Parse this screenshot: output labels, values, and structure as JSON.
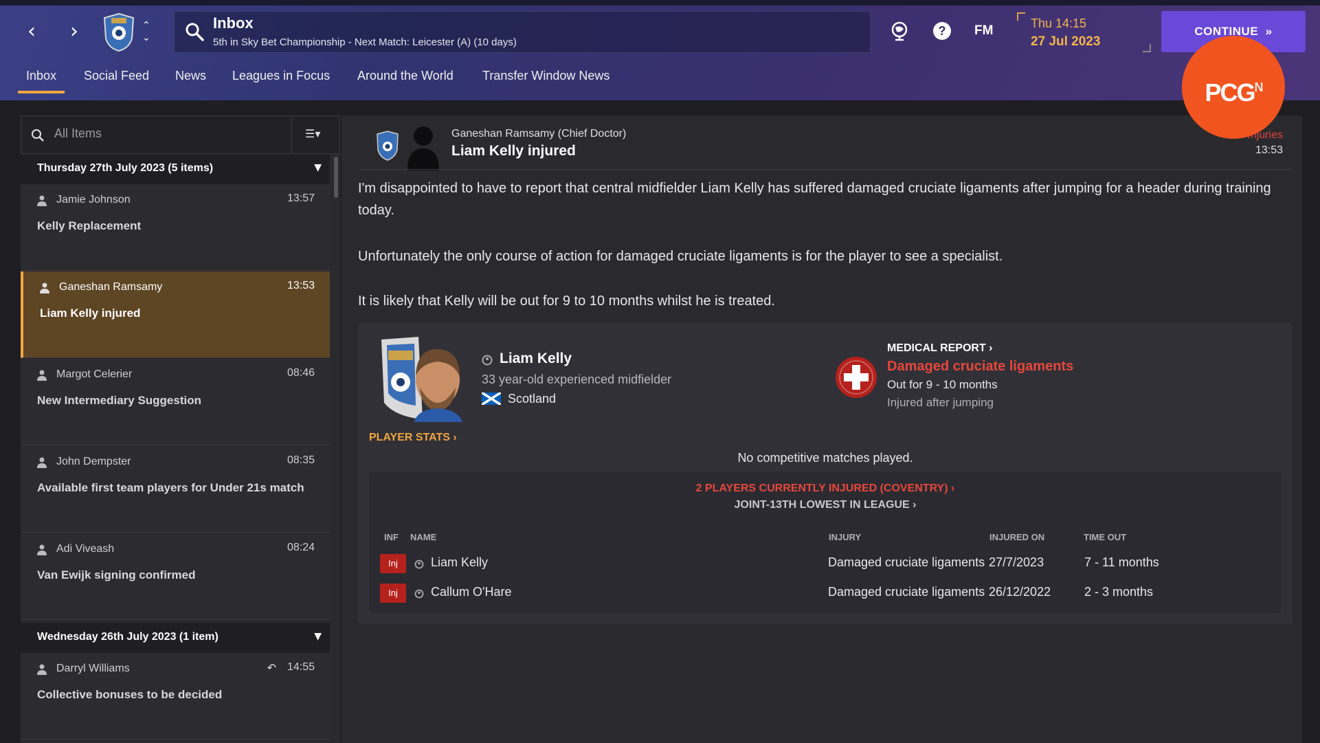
{
  "header": {
    "title": "Inbox",
    "subtitle": "5th in Sky Bet Championship - Next Match: Leicester (A) (10 days)",
    "time": "Thu 14:15",
    "date": "27 Jul 2023",
    "fm_label": "FM",
    "continue_label": "CONTINUE",
    "watermark": "PCGN"
  },
  "tabs": [
    "Inbox",
    "Social Feed",
    "News",
    "Leagues in Focus",
    "Around the World",
    "Transfer Window News"
  ],
  "inbox": {
    "search_placeholder": "All Items",
    "groups": [
      {
        "label": "Thursday 27th July 2023 (5 items)"
      },
      {
        "label": "Wednesday 26th July 2023 (1 item)"
      }
    ],
    "items": [
      {
        "from": "Jamie Johnson",
        "time": "13:57",
        "subject": "Kelly Replacement"
      },
      {
        "from": "Ganeshan Ramsamy",
        "time": "13:53",
        "subject": "Liam Kelly injured"
      },
      {
        "from": "Margot Celerier",
        "time": "08:46",
        "subject": "New Intermediary Suggestion"
      },
      {
        "from": "John Dempster",
        "time": "08:35",
        "subject": "Available first team players for Under 21s match"
      },
      {
        "from": "Adi Viveash",
        "time": "08:24",
        "subject": "Van Ewijk signing confirmed"
      },
      {
        "from": "Darryl Williams",
        "time": "14:55",
        "subject": "Collective bonuses to be decided"
      }
    ]
  },
  "message": {
    "from": "Ganeshan Ramsamy  (Chief Doctor)",
    "subject": "Liam Kelly injured",
    "tag": "Injuries",
    "time": "13:53",
    "paragraphs": [
      "I'm disappointed to have to report that central midfielder Liam Kelly has suffered damaged cruciate ligaments after jumping for a header during training today.",
      "Unfortunately the only course of action for damaged cruciate ligaments is for the player to see a specialist.",
      "It is likely that Kelly will be out for 9 to 10 months whilst he is treated."
    ]
  },
  "player": {
    "name": "Liam Kelly",
    "desc": "33 year-old experienced midfielder",
    "nation": "Scotland",
    "stats_link": "PLAYER STATS"
  },
  "medical": {
    "label": "MEDICAL REPORT",
    "injury": "Damaged cruciate ligaments",
    "out_for": "Out for 9 - 10 months",
    "cause": "Injured after jumping",
    "no_matches": "No competitive matches played."
  },
  "injury_table": {
    "headline": "2 PLAYERS CURRENTLY INJURED (COVENTRY)",
    "subline": "JOINT-13TH LOWEST IN LEAGUE",
    "columns": [
      "INF",
      "NAME",
      "INJURY",
      "INJURED ON",
      "TIME OUT"
    ],
    "rows": [
      {
        "inf": "Inj",
        "name": "Liam Kelly",
        "injury": "Damaged cruciate ligaments",
        "date": "27/7/2023",
        "out": "7 - 11 months"
      },
      {
        "inf": "Inj",
        "name": "Callum O'Hare",
        "injury": "Damaged cruciate ligaments",
        "date": "26/12/2022",
        "out": "2 - 3 months"
      }
    ]
  },
  "colors": {
    "accent": "#f0a640",
    "continue": "#6a48d8",
    "injury_red": "#e8473c"
  }
}
